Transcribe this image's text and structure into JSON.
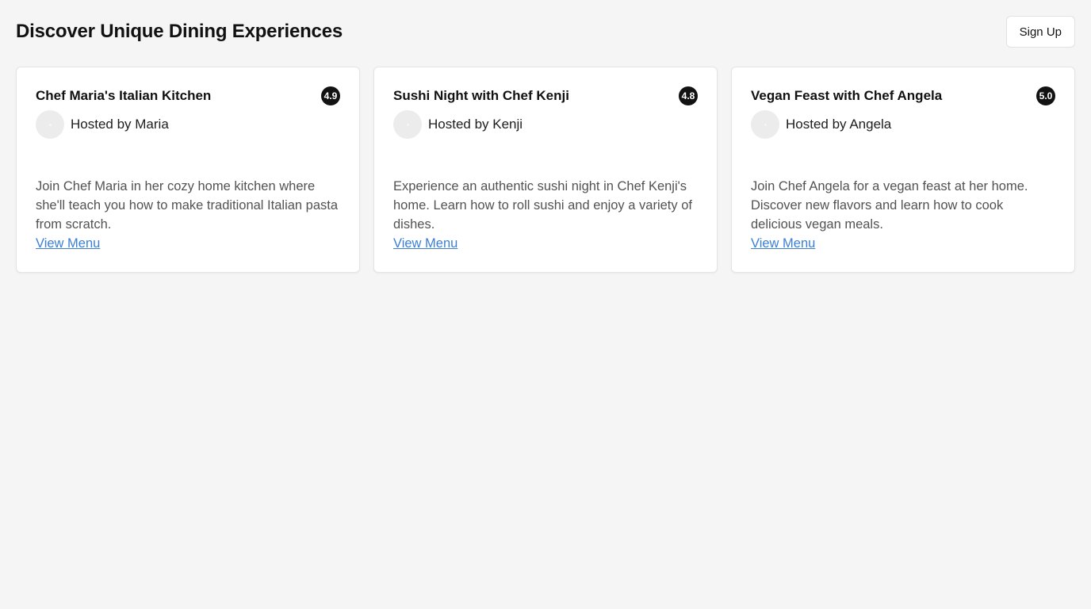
{
  "header": {
    "title": "Discover Unique Dining Experiences",
    "signup_label": "Sign Up"
  },
  "experiences": [
    {
      "title": "Chef Maria's Italian Kitchen",
      "rating": "4.9",
      "host": "Hosted by Maria",
      "description": "Join Chef Maria in her cozy home kitchen where she'll teach you how to make traditional Italian pasta from scratch.",
      "link_label": "View Menu"
    },
    {
      "title": "Sushi Night with Chef Kenji",
      "rating": "4.8",
      "host": "Hosted by Kenji",
      "description": "Experience an authentic sushi night in Chef Kenji's home. Learn how to roll sushi and enjoy a variety of dishes.",
      "link_label": "View Menu"
    },
    {
      "title": "Vegan Feast with Chef Angela",
      "rating": "5.0",
      "host": "Hosted by Angela",
      "description": "Join Chef Angela for a vegan feast at her home. Discover new flavors and learn how to cook delicious vegan meals.",
      "link_label": "View Menu"
    }
  ],
  "colors": {
    "background": "#f5f5f5",
    "card": "#ffffff",
    "badge": "#121212",
    "link": "#3b7fd4"
  }
}
